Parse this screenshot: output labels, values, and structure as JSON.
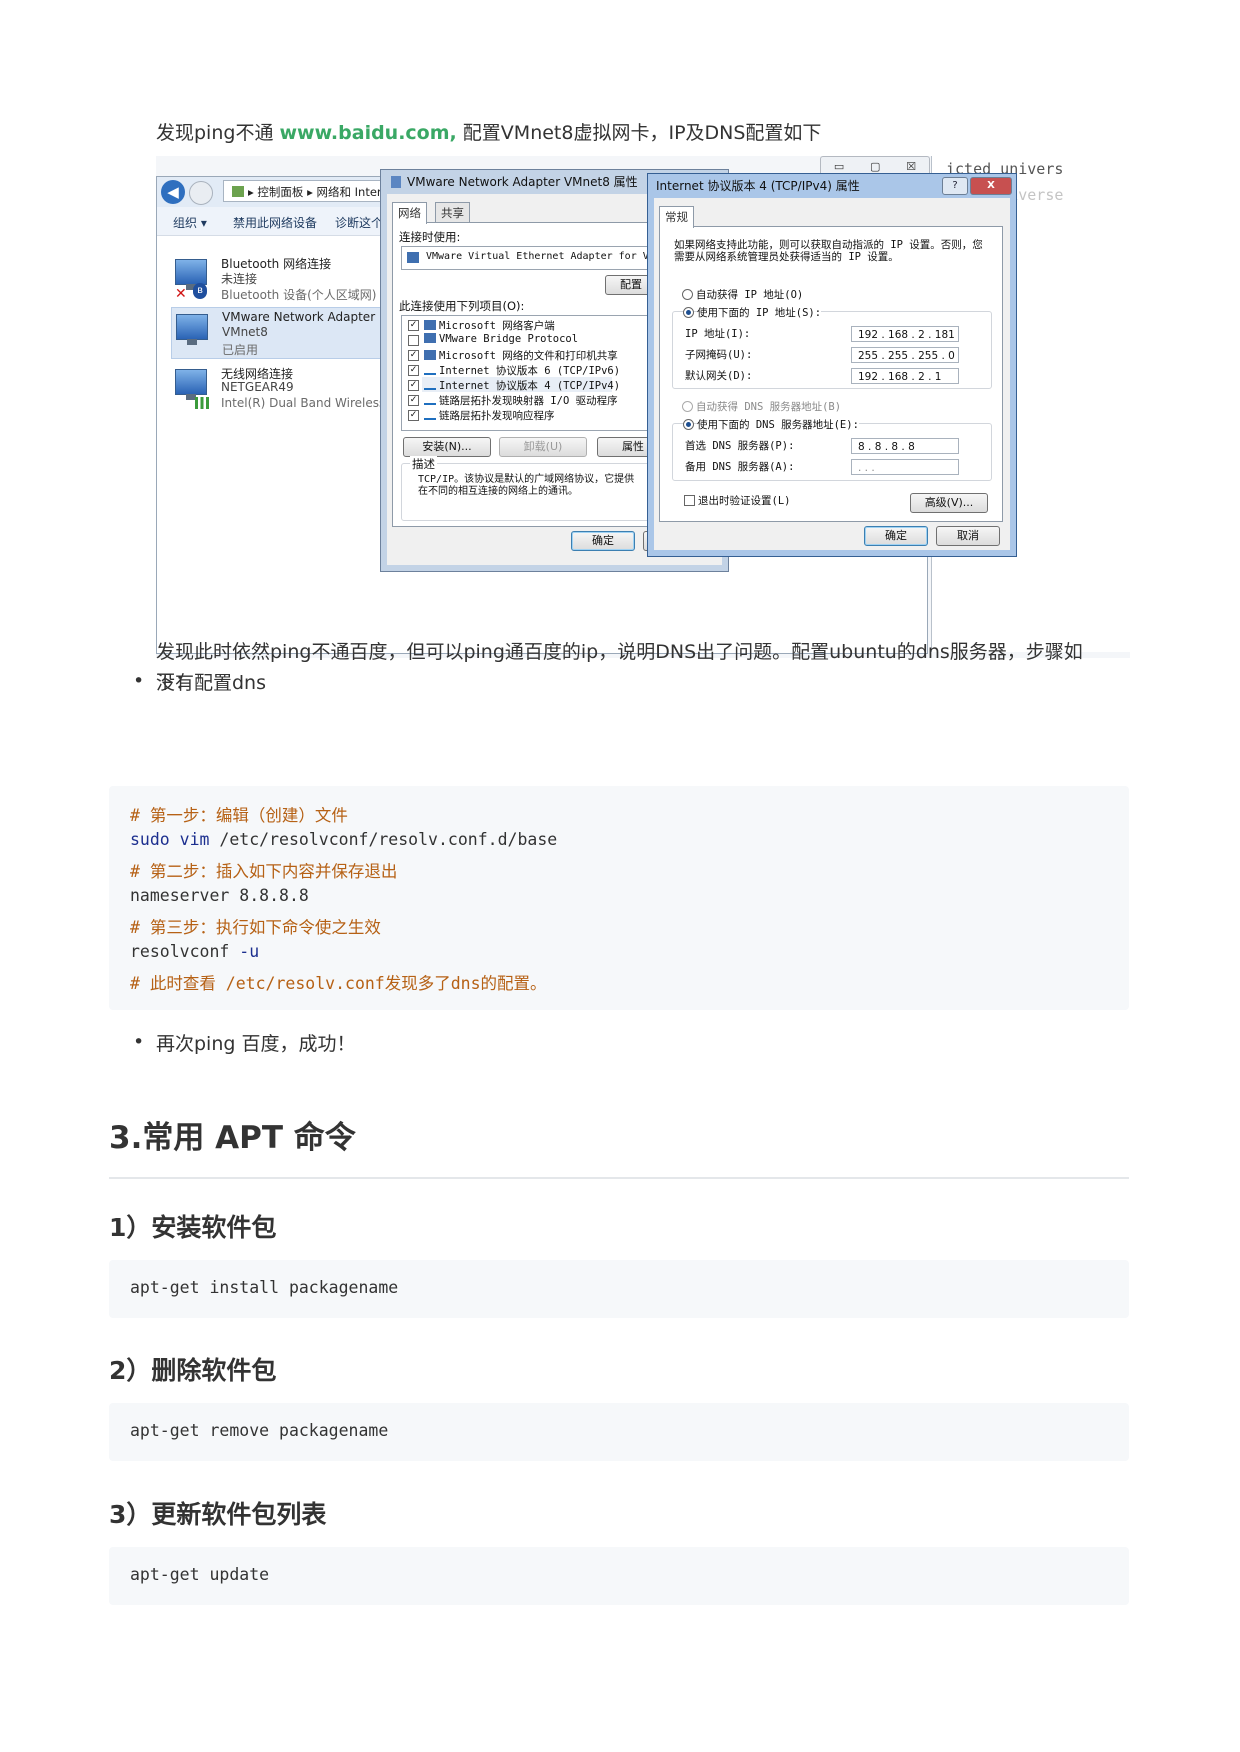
{
  "intro": {
    "before": "发现ping不通 ",
    "link": "www.baidu.com,",
    "after": " 配置VMnet8虚拟网卡，IP及DNS配置如下"
  },
  "screenshot": {
    "terminal_text": "icted univers",
    "terminal_text_faded": "cted universe",
    "window_controls": {
      "min": "▭",
      "max": "▢",
      "close": "☒"
    },
    "breadcrumb": "▸ 控制面板 ▸ 网络和 Interne",
    "toolbar": [
      "组织 ▾",
      "禁用此网络设备",
      "诊断这个连接"
    ],
    "adapters": [
      {
        "name": "Bluetooth 网络连接",
        "status": "未连接",
        "device": "Bluetooth 设备(个人区域网)"
      },
      {
        "name": "VMware Network Adapter",
        "status": "VMnet8",
        "device": "已启用"
      },
      {
        "name": "无线网络连接",
        "status": "NETGEAR49",
        "device": "Intel(R) Dual Band Wireless-A..."
      }
    ],
    "badges": {
      "x": "✕",
      "bluetooth": "ʙ"
    },
    "dialog1": {
      "title": "VMware Network Adapter VMnet8 属性",
      "tabs": [
        "网络",
        "共享"
      ],
      "connect_using_label": "连接时使用:",
      "adapter_name": "VMware Virtual Ethernet Adapter for VMne",
      "configure_button": "配置",
      "items_label": "此连接使用下列项目(O):",
      "check_mark": "✓",
      "items": [
        {
          "checked": true,
          "label": "Microsoft 网络客户端"
        },
        {
          "checked": false,
          "label": "VMware Bridge Protocol"
        },
        {
          "checked": true,
          "label": "Microsoft 网络的文件和打印机共享"
        },
        {
          "checked": true,
          "label": "Internet 协议版本 6 (TCP/IPv6)"
        },
        {
          "checked": true,
          "label": "Internet 协议版本 4 (TCP/IPv4)"
        },
        {
          "checked": true,
          "label": "链路层拓扑发现映射器 I/O 驱动程序"
        },
        {
          "checked": true,
          "label": "链路层拓扑发现响应程序"
        }
      ],
      "install_button": "安装(N)...",
      "uninstall_button": "卸载(U)",
      "properties_button": "属性",
      "description_label": "描述",
      "description_text": "TCP/IP。该协议是默认的广域网络协议，它提供在不同的相互连接的网络上的通讯。",
      "ok_button": "确定"
    },
    "dialog2": {
      "title": "Internet 协议版本 4 (TCP/IPv4) 属性",
      "help_button": "?",
      "close_button": "X",
      "tab": "常规",
      "intro_text": "如果网络支持此功能，则可以获取自动指派的 IP 设置。否则，您需要从网络系统管理员处获得适当的 IP 设置。",
      "auto_ip": "自动获得 IP 地址(O)",
      "manual_ip": "使用下面的 IP 地址(S):",
      "ip_label": "IP 地址(I):",
      "ip_value": "192 . 168 . 2 . 181",
      "mask_label": "子网掩码(U):",
      "mask_value": "255 . 255 . 255 . 0",
      "gateway_label": "默认网关(D):",
      "gateway_value": "192 . 168 . 2 . 1",
      "auto_dns": "自动获得 DNS 服务器地址(B)",
      "manual_dns": "使用下面的 DNS 服务器地址(E):",
      "preferred_dns_label": "首选 DNS 服务器(P):",
      "preferred_dns_value": "8 . 8 . 8 . 8",
      "alternate_dns_label": "备用 DNS 服务器(A):",
      "alternate_dns_value": ". . .",
      "validate_label": "退出时验证设置(L)",
      "advanced_button": "高级(V)...",
      "ok_button": "确定",
      "cancel_button": "取消"
    }
  },
  "bullet1": "没有配置dns",
  "bullet_marker": "•",
  "para": "发现此时依然ping不通百度，但可以ping通百度的ip，说明DNS出了问题。配置ubuntu的dns服务器，步骤如下：",
  "code_dns": [
    "# 第一步：编辑（创建）文件",
    "sudo vim /etc/resolvconf/resolv.conf.d/base",
    "# 第二步：插入如下内容并保存退出",
    "nameserver 8.8.8.8",
    "# 第三步：执行如下命令使之生效",
    "resolvconf -u",
    "# 此时查看 /etc/resolv.conf发现多了dns的配置。"
  ],
  "code_dns_parts": {
    "sudo": "sudo",
    "vim": " vim",
    "path": " /etc/resolvconf/resolv.conf.d/base",
    "ns": "nameserver",
    "ip": " 8.8.8.8",
    "rc": "resolvconf",
    "flag": " -u"
  },
  "bullet2": "再次ping 百度，成功！",
  "section_title": "3.常用 APT 命令",
  "subsections": [
    {
      "title": "1）安装软件包",
      "code": "apt-get install packagename"
    },
    {
      "title": "2）删除软件包",
      "code": "apt-get remove packagename"
    },
    {
      "title": "3）更新软件包列表",
      "code": "apt-get update"
    }
  ]
}
